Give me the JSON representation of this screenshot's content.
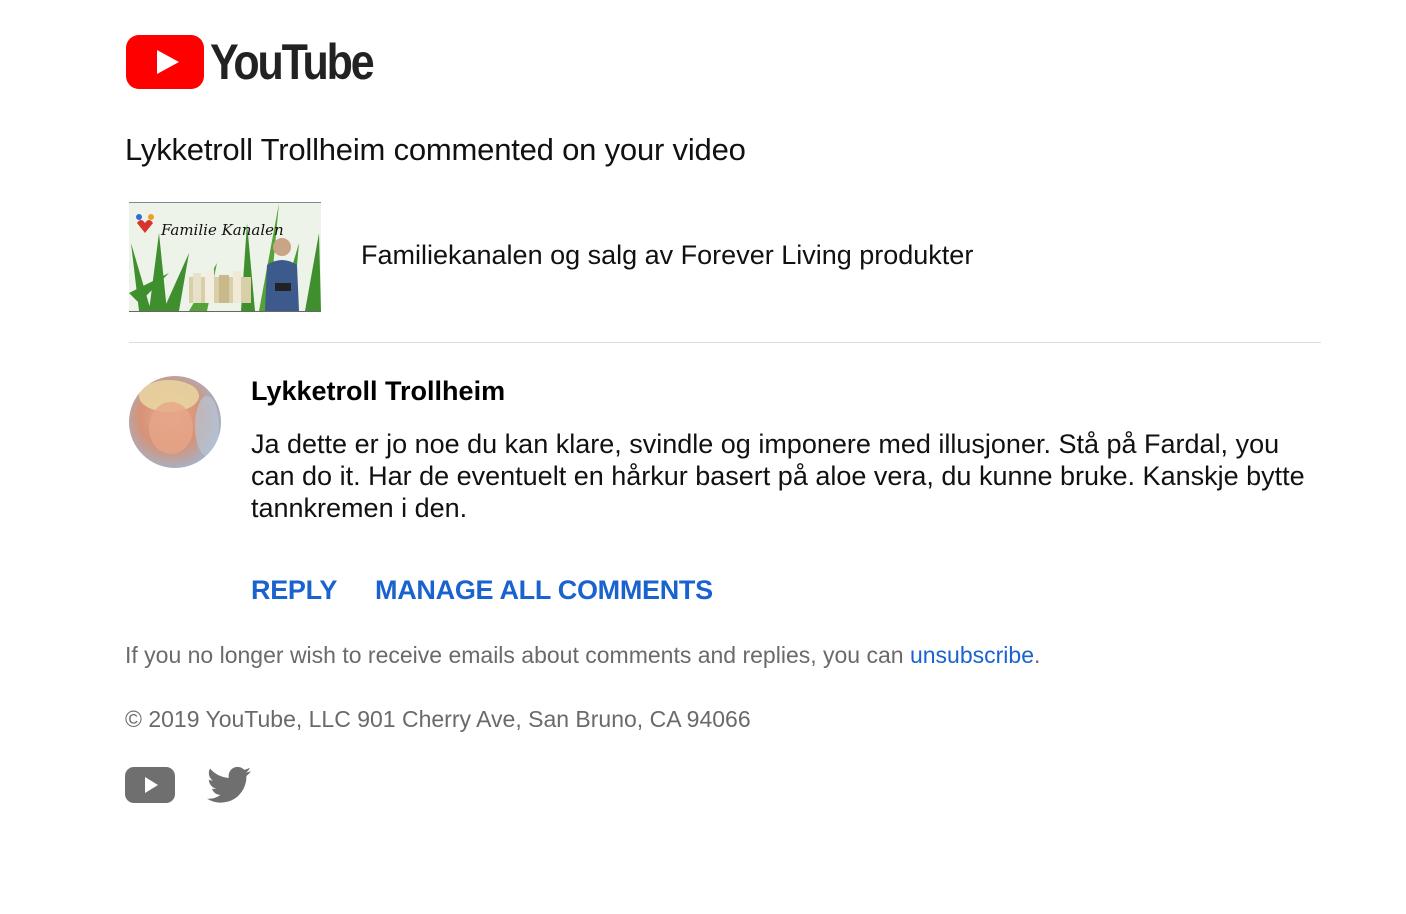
{
  "brand": {
    "logo_icon": "youtube-logo-icon",
    "logo_text": "YouTube",
    "red": "#ff0000"
  },
  "notification": {
    "headline": "Lykketroll Trollheim commented on your video"
  },
  "video": {
    "thumbnail_text": "Familie Kanalen",
    "title": "Familiekanalen og salg av Forever Living produkter"
  },
  "comment": {
    "author": "Lykketroll Trollheim",
    "text": "Ja dette er jo noe du kan klare, svindle og imponere med illusjoner. Stå på Fardal, you can do it. Har de eventuelt en hårkur basert på aloe vera, du kunne bruke. Kanskje bytte tannkremen i den."
  },
  "actions": {
    "reply_label": "REPLY",
    "manage_label": "MANAGE ALL COMMENTS",
    "link_color": "#1a63cf"
  },
  "footer": {
    "unsubscribe_prefix": "If you no longer wish to receive emails about comments and replies, you can ",
    "unsubscribe_link": "unsubscribe",
    "unsubscribe_suffix": ".",
    "copyright": "© 2019 YouTube, LLC 901 Cherry Ave, San Bruno, CA 94066",
    "social_icons": [
      "youtube-icon",
      "twitter-icon"
    ]
  }
}
